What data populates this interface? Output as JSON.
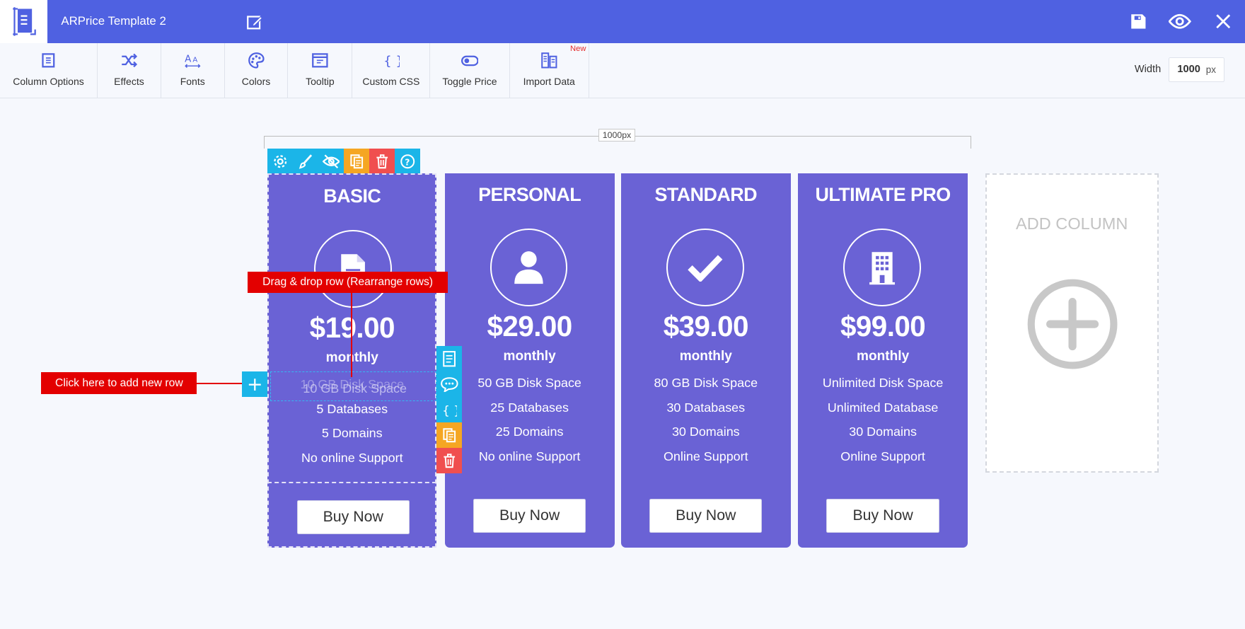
{
  "header": {
    "title": "ARPrice Template 2",
    "logo_icon": "document-logo-icon",
    "actions": [
      "save-icon",
      "preview-eye-icon",
      "close-icon"
    ],
    "bg_color": "#4f61e1"
  },
  "toolbar": {
    "items": [
      {
        "label": "Column Options",
        "icon": "column-options-icon"
      },
      {
        "label": "Effects",
        "icon": "shuffle-icon"
      },
      {
        "label": "Fonts",
        "icon": "font-size-icon"
      },
      {
        "label": "Colors",
        "icon": "palette-icon"
      },
      {
        "label": "Tooltip",
        "icon": "tooltip-icon"
      },
      {
        "label": "Custom CSS",
        "icon": "braces-icon"
      },
      {
        "label": "Toggle Price",
        "icon": "toggle-icon"
      },
      {
        "label": "Import Data",
        "icon": "import-data-icon"
      }
    ],
    "new_badge": "New",
    "width_label": "Width",
    "width_value": "1000",
    "width_unit": "px"
  },
  "canvas": {
    "ruler_label": "1000px",
    "column_actions": [
      "settings-icon",
      "brush-icon",
      "hide-eye-icon",
      "duplicate-icon",
      "delete-icon",
      "help-icon"
    ],
    "row_actions": [
      "row-options-icon",
      "tooltip-icon",
      "braces-icon",
      "duplicate-icon",
      "delete-icon"
    ],
    "callouts": {
      "drag_row": "Drag & drop row (Rearrange rows)",
      "add_row": "Click here to add new row"
    },
    "add_row_symbol": "+",
    "drag_ghost": "10 GB Disk Space"
  },
  "columns": [
    {
      "name": "BASIC",
      "icon": "document-icon",
      "price": "$19.00",
      "period": "monthly",
      "features": [
        "10 GB Disk Space",
        "5 Databases",
        "5 Domains",
        "No online Support"
      ],
      "button": "Buy Now"
    },
    {
      "name": "PERSONAL",
      "icon": "user-icon",
      "price": "$29.00",
      "period": "monthly",
      "features": [
        "50 GB Disk Space",
        "25 Databases",
        "25 Domains",
        "No online Support"
      ],
      "button": "Buy Now"
    },
    {
      "name": "STANDARD",
      "icon": "checkmark-icon",
      "price": "$39.00",
      "period": "monthly",
      "features": [
        "80 GB Disk Space",
        "30 Databases",
        "30 Domains",
        "Online Support"
      ],
      "button": "Buy Now"
    },
    {
      "name": "ULTIMATE PRO",
      "icon": "building-icon",
      "price": "$99.00",
      "period": "monthly",
      "features": [
        "Unlimited Disk Space",
        "Unlimited Database",
        "30 Domains",
        "Online Support"
      ],
      "button": "Buy Now"
    }
  ],
  "add_column": {
    "label": "ADD COLUMN",
    "icon": "plus-circle-icon"
  },
  "colors": {
    "column_bg": "#6a62d5",
    "accent_cyan": "#1bb5e8",
    "orange": "#f5a623",
    "red": "#f04f4f",
    "callout_red": "#e30000"
  }
}
